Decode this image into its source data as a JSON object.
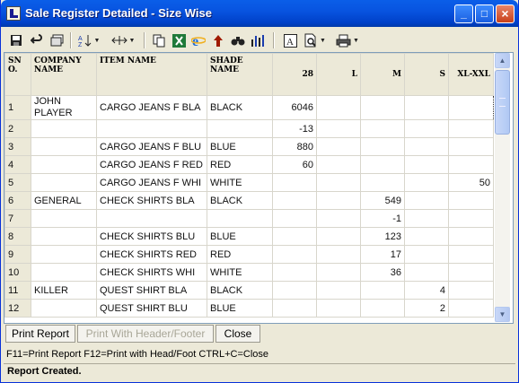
{
  "window": {
    "title": "Sale Register Detailed - Size Wise"
  },
  "titlebar": {
    "min": "_",
    "max": "□",
    "close": "×"
  },
  "toolbar": {
    "icons": [
      "save-icon",
      "undo-icon",
      "window-icon",
      "sort-icon",
      "column-width-icon",
      "copy-icon",
      "excel-icon",
      "internet-explorer-icon",
      "find-icon",
      "up-arrow-icon",
      "chart-icon",
      "font-icon",
      "print-preview-icon",
      "printer-icon"
    ]
  },
  "grid": {
    "headers": [
      "SN O.",
      "COMPANY NAME",
      "ITEM NAME",
      "SHADE NAME",
      "28",
      "L",
      "M",
      "S",
      "XL-XXL"
    ],
    "rows": [
      {
        "sn": "1",
        "company": "JOHN PLAYER",
        "item": "CARGO JEANS F BLA",
        "shade": "BLACK",
        "c28": "6046",
        "l": "",
        "m": "",
        "s": "",
        "xl": ""
      },
      {
        "sn": "2",
        "company": "",
        "item": "",
        "shade": "",
        "c28": "-13",
        "l": "",
        "m": "",
        "s": "",
        "xl": ""
      },
      {
        "sn": "3",
        "company": "",
        "item": "CARGO JEANS F BLU",
        "shade": "BLUE",
        "c28": "880",
        "l": "",
        "m": "",
        "s": "",
        "xl": ""
      },
      {
        "sn": "4",
        "company": "",
        "item": "CARGO JEANS F RED",
        "shade": "RED",
        "c28": "60",
        "l": "",
        "m": "",
        "s": "",
        "xl": ""
      },
      {
        "sn": "5",
        "company": "",
        "item": "CARGO JEANS F WHI",
        "shade": "WHITE",
        "c28": "",
        "l": "",
        "m": "",
        "s": "",
        "xl": "50"
      },
      {
        "sn": "6",
        "company": "GENERAL",
        "item": "CHECK SHIRTS BLA",
        "shade": "BLACK",
        "c28": "",
        "l": "",
        "m": "549",
        "s": "",
        "xl": ""
      },
      {
        "sn": "7",
        "company": "",
        "item": "",
        "shade": "",
        "c28": "",
        "l": "",
        "m": "-1",
        "s": "",
        "xl": ""
      },
      {
        "sn": "8",
        "company": "",
        "item": "CHECK SHIRTS BLU",
        "shade": "BLUE",
        "c28": "",
        "l": "",
        "m": "123",
        "s": "",
        "xl": ""
      },
      {
        "sn": "9",
        "company": "",
        "item": "CHECK SHIRTS RED",
        "shade": "RED",
        "c28": "",
        "l": "",
        "m": "17",
        "s": "",
        "xl": ""
      },
      {
        "sn": "10",
        "company": "",
        "item": "CHECK SHIRTS WHI",
        "shade": "WHITE",
        "c28": "",
        "l": "",
        "m": "36",
        "s": "",
        "xl": ""
      },
      {
        "sn": "11",
        "company": "KILLER",
        "item": "QUEST SHIRT BLA",
        "shade": "BLACK",
        "c28": "",
        "l": "",
        "m": "",
        "s": "4",
        "xl": ""
      },
      {
        "sn": "12",
        "company": "",
        "item": "QUEST SHIRT BLU",
        "shade": "BLUE",
        "c28": "",
        "l": "",
        "m": "",
        "s": "2",
        "xl": ""
      }
    ]
  },
  "buttons": {
    "print_report": "Print Report",
    "print_header": "Print With Header/Footer",
    "close": "Close"
  },
  "hint": "F11=Print Report  F12=Print with Head/Foot  CTRL+C=Close",
  "status": "Report Created."
}
